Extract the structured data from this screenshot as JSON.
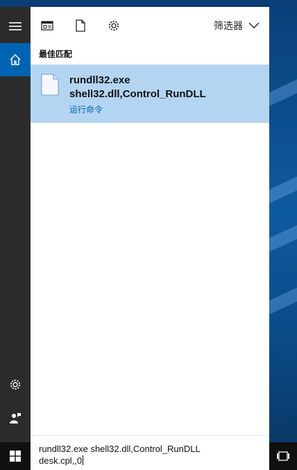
{
  "toolbar": {
    "apps_icon": "app-window-icon",
    "documents_icon": "document-icon",
    "settings_icon": "gear-icon",
    "filter_label": "筛选器",
    "filter_icon": "chevron-down-icon"
  },
  "rail": {
    "menu_icon": "hamburger-menu-icon",
    "home_icon": "home-icon",
    "settings_icon": "gear-icon",
    "account_icon": "user-feedback-icon"
  },
  "results": {
    "section_title": "最佳匹配",
    "best_match": {
      "icon": "file-icon",
      "line1": "rundll32.exe",
      "line2": "shell32.dll,Control_RunDLL",
      "subtitle": "运行命令"
    }
  },
  "search": {
    "query_line1": "rundll32.exe shell32.dll,Control_RunDLL",
    "query_line2": "desk.cpl,,0"
  },
  "taskbar": {
    "start_icon": "windows-logo-icon",
    "task_view_icon": "task-view-icon"
  },
  "colors": {
    "accent": "#0063b1",
    "selection": "#b4d5f2",
    "rail": "#2b2b2b",
    "taskbar": "#101010"
  }
}
